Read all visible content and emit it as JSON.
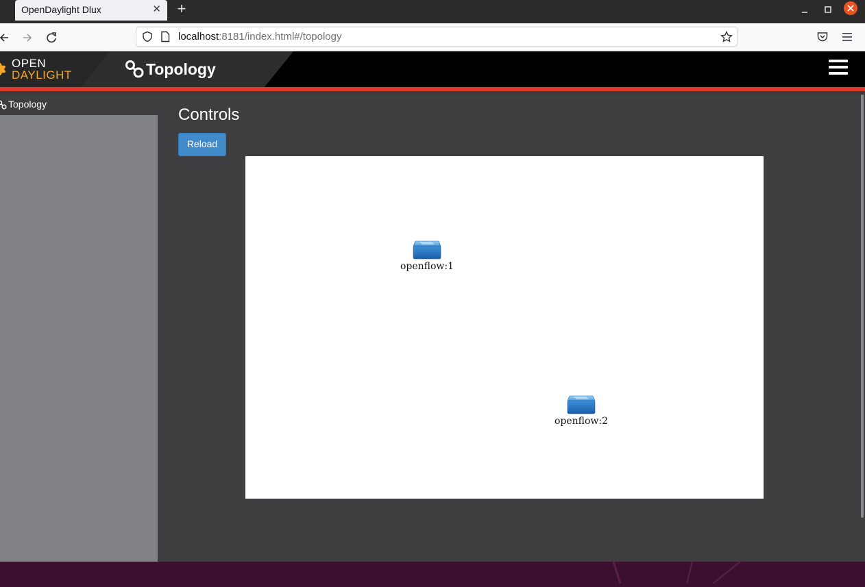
{
  "browser": {
    "tab_title": "OpenDaylight Dlux",
    "tab_close": "✕",
    "new_tab": "+",
    "url_host": "localhost",
    "url_rest": ":8181/index.html#/topology"
  },
  "header": {
    "logo_line1": "OPEN",
    "logo_line2": "DAYLIGHT",
    "title": "Topology"
  },
  "sidebar": {
    "items": [
      {
        "label": "Topology",
        "icon": "topology-icon"
      }
    ]
  },
  "main": {
    "section_title": "Controls",
    "reload_label": "Reload"
  },
  "topology": {
    "nodes": [
      {
        "id": "openflow:1",
        "icon": "switch-icon"
      },
      {
        "id": "openflow:2",
        "icon": "switch-icon"
      }
    ],
    "links": []
  },
  "colors": {
    "accent_red": "#e03a2d",
    "logo_orange": "#f5a623",
    "button_blue": "#428bca",
    "panel_dark": "#3e3e40",
    "sidebar_gray": "#818286"
  }
}
